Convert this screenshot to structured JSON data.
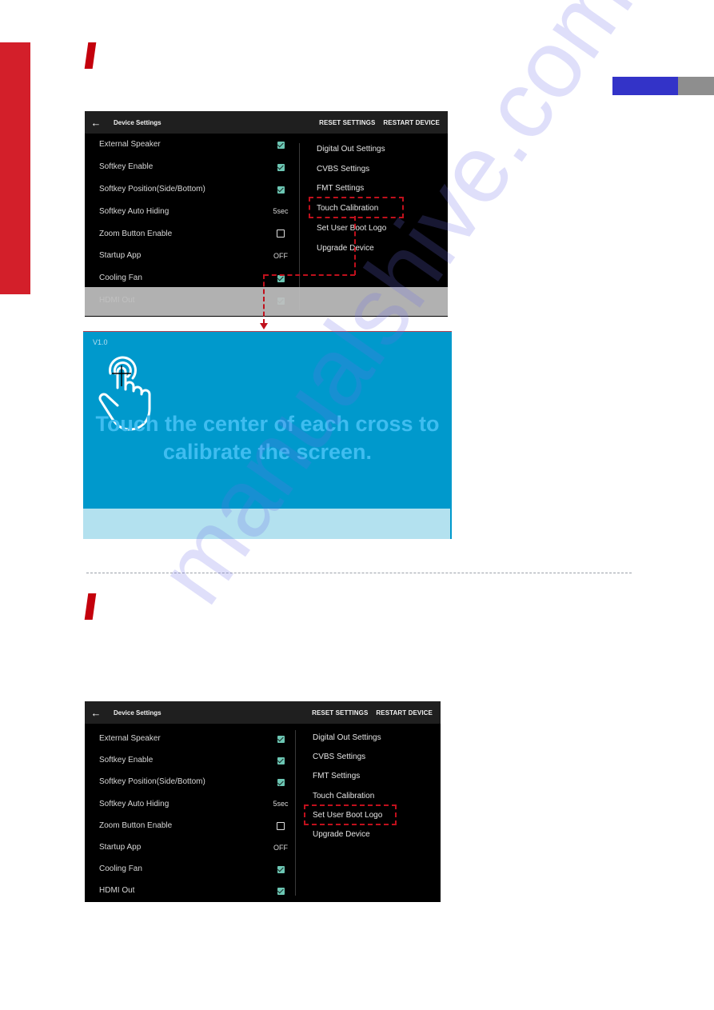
{
  "page": {
    "watermark": "manualshive.com",
    "colors": {
      "side_bar": "#d31f2a",
      "accent_slash": "#c4000c",
      "tab_blue": "#3333c8",
      "tab_gray": "#8e8e8e",
      "highlight": "#c0101c",
      "calibration_bg": "#0099cc",
      "checkbox_on": "#6cc6b3"
    }
  },
  "screenshot1": {
    "title": "Device Settings",
    "actions": [
      "RESET SETTINGS",
      "RESTART DEVICE"
    ],
    "settings": [
      {
        "label": "External Speaker",
        "type": "checkbox",
        "checked": true
      },
      {
        "label": "Softkey Enable",
        "type": "checkbox",
        "checked": true
      },
      {
        "label": "Softkey Position(Side/Bottom)",
        "type": "checkbox",
        "checked": true
      },
      {
        "label": "Softkey Auto Hiding",
        "type": "value",
        "value": "5sec"
      },
      {
        "label": "Zoom Button Enable",
        "type": "checkbox",
        "checked": false
      },
      {
        "label": "Startup App",
        "type": "value",
        "value": "OFF"
      },
      {
        "label": "Cooling Fan",
        "type": "checkbox",
        "checked": true
      },
      {
        "label": "HDMI Out",
        "type": "checkbox",
        "checked": true
      }
    ],
    "menu": [
      "Digital Out Settings",
      "CVBS Settings",
      "FMT Settings",
      "Touch Calibration",
      "Set User Boot Logo",
      "Upgrade Device"
    ],
    "highlighted_menu": "Touch Calibration"
  },
  "calibration": {
    "version": "V1.0",
    "message_line1": "Touch the center of each cross to",
    "message_line2": "calibrate the screen.",
    "icon": "touch-hand-icon"
  },
  "screenshot2": {
    "title": "Device Settings",
    "actions": [
      "RESET SETTINGS",
      "RESTART DEVICE"
    ],
    "settings": [
      {
        "label": "External Speaker",
        "type": "checkbox",
        "checked": true
      },
      {
        "label": "Softkey Enable",
        "type": "checkbox",
        "checked": true
      },
      {
        "label": "Softkey Position(Side/Bottom)",
        "type": "checkbox",
        "checked": true
      },
      {
        "label": "Softkey Auto Hiding",
        "type": "value",
        "value": "5sec"
      },
      {
        "label": "Zoom Button Enable",
        "type": "checkbox",
        "checked": false
      },
      {
        "label": "Startup App",
        "type": "value",
        "value": "OFF"
      },
      {
        "label": "Cooling Fan",
        "type": "checkbox",
        "checked": true
      },
      {
        "label": "HDMI Out",
        "type": "checkbox",
        "checked": true
      }
    ],
    "menu": [
      "Digital Out Settings",
      "CVBS Settings",
      "FMT Settings",
      "Touch Calibration",
      "Set User Boot Logo",
      "Upgrade Device"
    ],
    "highlighted_menu": "Set User Boot Logo"
  }
}
